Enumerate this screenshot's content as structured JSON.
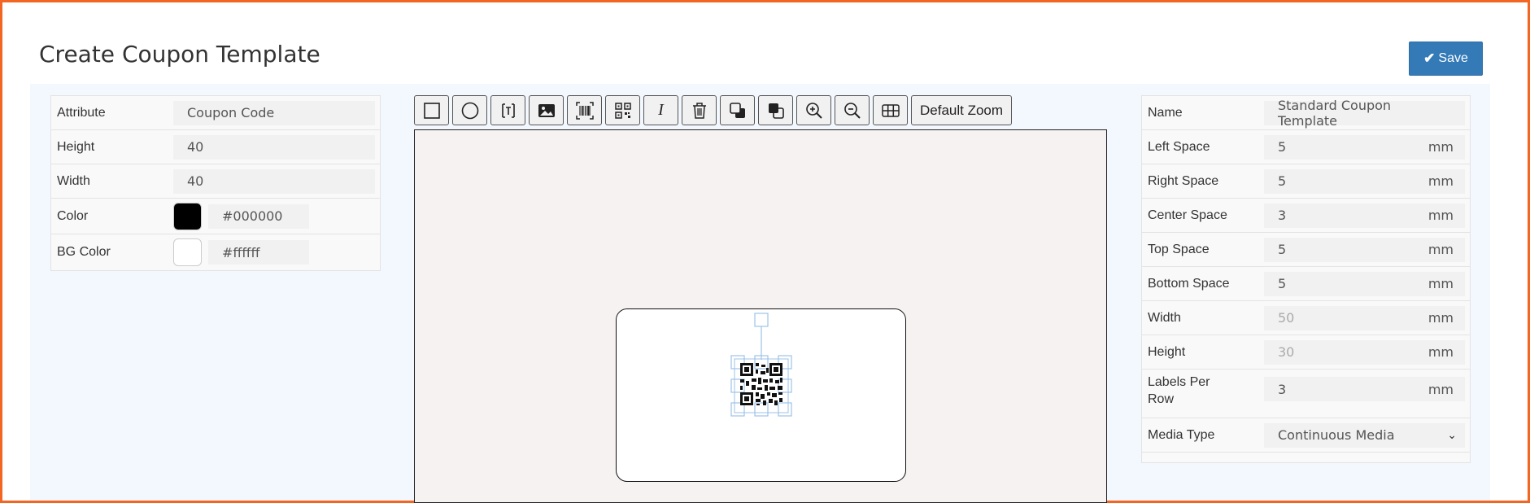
{
  "header": {
    "title": "Create Coupon Template",
    "save_label": "Save"
  },
  "attributes": {
    "attribute_label": "Attribute",
    "attribute_value": "Coupon Code",
    "height_label": "Height",
    "height_value": "40",
    "width_label": "Width",
    "width_value": "40",
    "color_label": "Color",
    "color_value": "#000000",
    "bg_color_label": "BG Color",
    "bg_color_value": "#ffffff"
  },
  "toolbar": {
    "default_zoom_label": "Default Zoom",
    "text_tool_glyph": "I"
  },
  "toolbar_icons": [
    "rectangle-icon",
    "circle-icon",
    "text-box-icon",
    "image-icon",
    "barcode-icon",
    "qr-code-icon",
    "italic-text-icon",
    "trash-icon",
    "send-backward-icon",
    "bring-forward-icon",
    "zoom-in-icon",
    "zoom-out-icon",
    "grid-icon"
  ],
  "setup": {
    "name_label": "Name",
    "name_value": "Standard Coupon Template",
    "left_space_label": "Left Space",
    "left_space_value": "5",
    "right_space_label": "Right Space",
    "right_space_value": "5",
    "center_space_label": "Center Space",
    "center_space_value": "3",
    "top_space_label": "Top Space",
    "top_space_value": "5",
    "bottom_space_label": "Bottom Space",
    "bottom_space_value": "5",
    "width_label": "Width",
    "width_value": "50",
    "height_label": "Height",
    "height_value": "30",
    "labels_per_row_label": "Labels Per Row",
    "labels_per_row_value": "3",
    "media_type_label": "Media Type",
    "media_type_value": "Continuous Media",
    "unit": "mm"
  },
  "colors": {
    "accent": "#337ab7",
    "frame": "#f26522",
    "content_bg": "#f2f8fe",
    "canvas_bg": "#f6f2f1",
    "selection": "#9cc3ea"
  }
}
